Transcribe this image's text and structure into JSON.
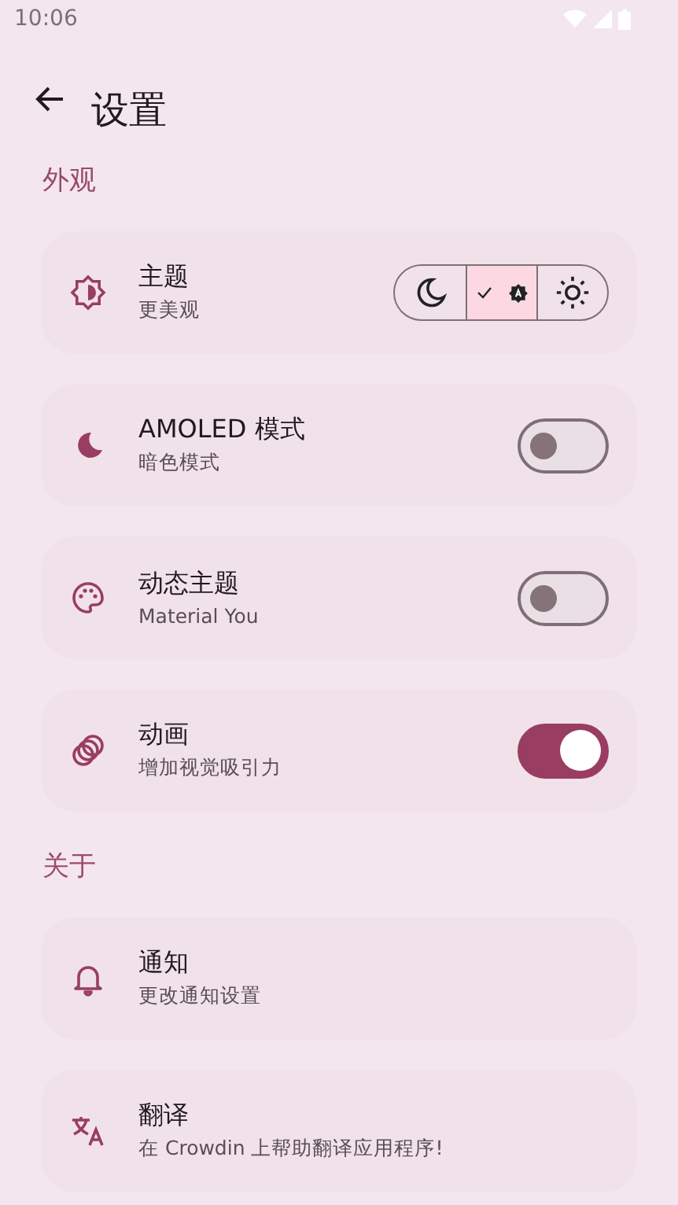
{
  "status_bar": {
    "time": "10:06"
  },
  "header": {
    "title": "设置"
  },
  "sections": [
    {
      "title": "外观",
      "items": [
        {
          "kind": "segmented",
          "title": "主题",
          "subtitle": "更美观",
          "options": [
            {
              "selected": false
            },
            {
              "selected": true
            },
            {
              "selected": false
            }
          ]
        },
        {
          "kind": "switch",
          "title": "AMOLED 模式",
          "subtitle": "暗色模式",
          "on": false
        },
        {
          "kind": "switch",
          "title": "动态主题",
          "subtitle": "Material You",
          "on": false
        },
        {
          "kind": "switch",
          "title": "动画",
          "subtitle": "增加视觉吸引力",
          "on": true
        }
      ]
    },
    {
      "title": "关于",
      "items": [
        {
          "kind": "link",
          "title": "通知",
          "subtitle": "更改通知设置"
        },
        {
          "kind": "link",
          "title": "翻译",
          "subtitle": "在 Crowdin 上帮助翻译应用程序!"
        }
      ]
    }
  ]
}
